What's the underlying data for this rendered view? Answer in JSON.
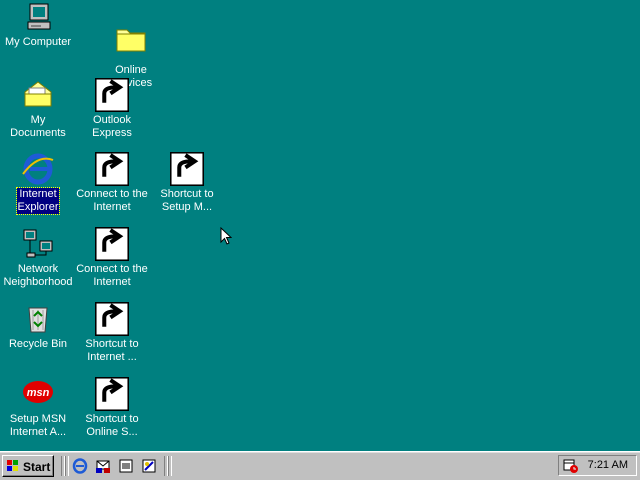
{
  "desktop": {
    "background": "#008080",
    "icons": [
      {
        "label": "My Computer"
      },
      {
        "label": "Online\nServices"
      },
      {
        "label": "My Documents"
      },
      {
        "label": "Outlook\nExpress"
      },
      {
        "label": "Internet\nExplorer"
      },
      {
        "label": "Connect to the\nInternet"
      },
      {
        "label": "Shortcut to\nSetup M..."
      },
      {
        "label": "Network\nNeighborhood"
      },
      {
        "label": "Connect to the\nInternet"
      },
      {
        "label": "Recycle Bin"
      },
      {
        "label": "Shortcut to\nInternet ..."
      },
      {
        "label": "Setup MSN\nInternet A..."
      },
      {
        "label": "Shortcut to\nOnline S..."
      }
    ],
    "msn_text": "msn"
  },
  "taskbar": {
    "start_label": "Start",
    "clock": "7:21 AM"
  }
}
